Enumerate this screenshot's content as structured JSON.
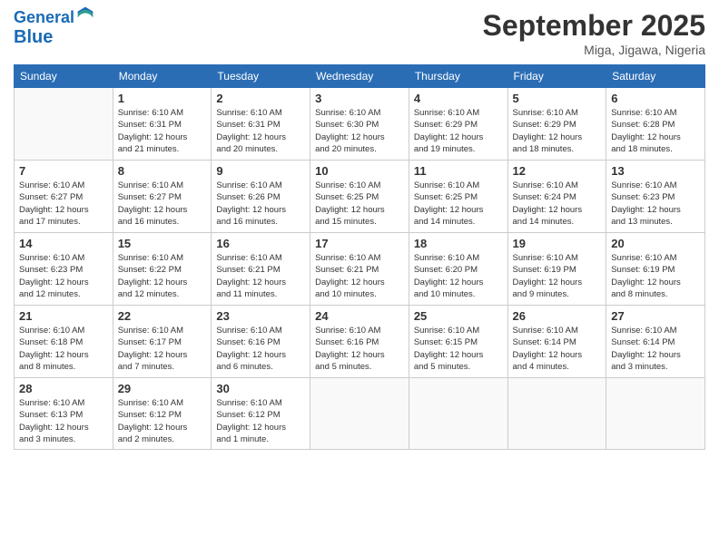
{
  "header": {
    "logo_line1": "General",
    "logo_line2": "Blue",
    "month_title": "September 2025",
    "location": "Miga, Jigawa, Nigeria"
  },
  "days_of_week": [
    "Sunday",
    "Monday",
    "Tuesday",
    "Wednesday",
    "Thursday",
    "Friday",
    "Saturday"
  ],
  "weeks": [
    [
      {
        "day": "",
        "info": ""
      },
      {
        "day": "1",
        "info": "Sunrise: 6:10 AM\nSunset: 6:31 PM\nDaylight: 12 hours\nand 21 minutes."
      },
      {
        "day": "2",
        "info": "Sunrise: 6:10 AM\nSunset: 6:31 PM\nDaylight: 12 hours\nand 20 minutes."
      },
      {
        "day": "3",
        "info": "Sunrise: 6:10 AM\nSunset: 6:30 PM\nDaylight: 12 hours\nand 20 minutes."
      },
      {
        "day": "4",
        "info": "Sunrise: 6:10 AM\nSunset: 6:29 PM\nDaylight: 12 hours\nand 19 minutes."
      },
      {
        "day": "5",
        "info": "Sunrise: 6:10 AM\nSunset: 6:29 PM\nDaylight: 12 hours\nand 18 minutes."
      },
      {
        "day": "6",
        "info": "Sunrise: 6:10 AM\nSunset: 6:28 PM\nDaylight: 12 hours\nand 18 minutes."
      }
    ],
    [
      {
        "day": "7",
        "info": "Sunrise: 6:10 AM\nSunset: 6:27 PM\nDaylight: 12 hours\nand 17 minutes."
      },
      {
        "day": "8",
        "info": "Sunrise: 6:10 AM\nSunset: 6:27 PM\nDaylight: 12 hours\nand 16 minutes."
      },
      {
        "day": "9",
        "info": "Sunrise: 6:10 AM\nSunset: 6:26 PM\nDaylight: 12 hours\nand 16 minutes."
      },
      {
        "day": "10",
        "info": "Sunrise: 6:10 AM\nSunset: 6:25 PM\nDaylight: 12 hours\nand 15 minutes."
      },
      {
        "day": "11",
        "info": "Sunrise: 6:10 AM\nSunset: 6:25 PM\nDaylight: 12 hours\nand 14 minutes."
      },
      {
        "day": "12",
        "info": "Sunrise: 6:10 AM\nSunset: 6:24 PM\nDaylight: 12 hours\nand 14 minutes."
      },
      {
        "day": "13",
        "info": "Sunrise: 6:10 AM\nSunset: 6:23 PM\nDaylight: 12 hours\nand 13 minutes."
      }
    ],
    [
      {
        "day": "14",
        "info": "Sunrise: 6:10 AM\nSunset: 6:23 PM\nDaylight: 12 hours\nand 12 minutes."
      },
      {
        "day": "15",
        "info": "Sunrise: 6:10 AM\nSunset: 6:22 PM\nDaylight: 12 hours\nand 12 minutes."
      },
      {
        "day": "16",
        "info": "Sunrise: 6:10 AM\nSunset: 6:21 PM\nDaylight: 12 hours\nand 11 minutes."
      },
      {
        "day": "17",
        "info": "Sunrise: 6:10 AM\nSunset: 6:21 PM\nDaylight: 12 hours\nand 10 minutes."
      },
      {
        "day": "18",
        "info": "Sunrise: 6:10 AM\nSunset: 6:20 PM\nDaylight: 12 hours\nand 10 minutes."
      },
      {
        "day": "19",
        "info": "Sunrise: 6:10 AM\nSunset: 6:19 PM\nDaylight: 12 hours\nand 9 minutes."
      },
      {
        "day": "20",
        "info": "Sunrise: 6:10 AM\nSunset: 6:19 PM\nDaylight: 12 hours\nand 8 minutes."
      }
    ],
    [
      {
        "day": "21",
        "info": "Sunrise: 6:10 AM\nSunset: 6:18 PM\nDaylight: 12 hours\nand 8 minutes."
      },
      {
        "day": "22",
        "info": "Sunrise: 6:10 AM\nSunset: 6:17 PM\nDaylight: 12 hours\nand 7 minutes."
      },
      {
        "day": "23",
        "info": "Sunrise: 6:10 AM\nSunset: 6:16 PM\nDaylight: 12 hours\nand 6 minutes."
      },
      {
        "day": "24",
        "info": "Sunrise: 6:10 AM\nSunset: 6:16 PM\nDaylight: 12 hours\nand 5 minutes."
      },
      {
        "day": "25",
        "info": "Sunrise: 6:10 AM\nSunset: 6:15 PM\nDaylight: 12 hours\nand 5 minutes."
      },
      {
        "day": "26",
        "info": "Sunrise: 6:10 AM\nSunset: 6:14 PM\nDaylight: 12 hours\nand 4 minutes."
      },
      {
        "day": "27",
        "info": "Sunrise: 6:10 AM\nSunset: 6:14 PM\nDaylight: 12 hours\nand 3 minutes."
      }
    ],
    [
      {
        "day": "28",
        "info": "Sunrise: 6:10 AM\nSunset: 6:13 PM\nDaylight: 12 hours\nand 3 minutes."
      },
      {
        "day": "29",
        "info": "Sunrise: 6:10 AM\nSunset: 6:12 PM\nDaylight: 12 hours\nand 2 minutes."
      },
      {
        "day": "30",
        "info": "Sunrise: 6:10 AM\nSunset: 6:12 PM\nDaylight: 12 hours\nand 1 minute."
      },
      {
        "day": "",
        "info": ""
      },
      {
        "day": "",
        "info": ""
      },
      {
        "day": "",
        "info": ""
      },
      {
        "day": "",
        "info": ""
      }
    ]
  ]
}
